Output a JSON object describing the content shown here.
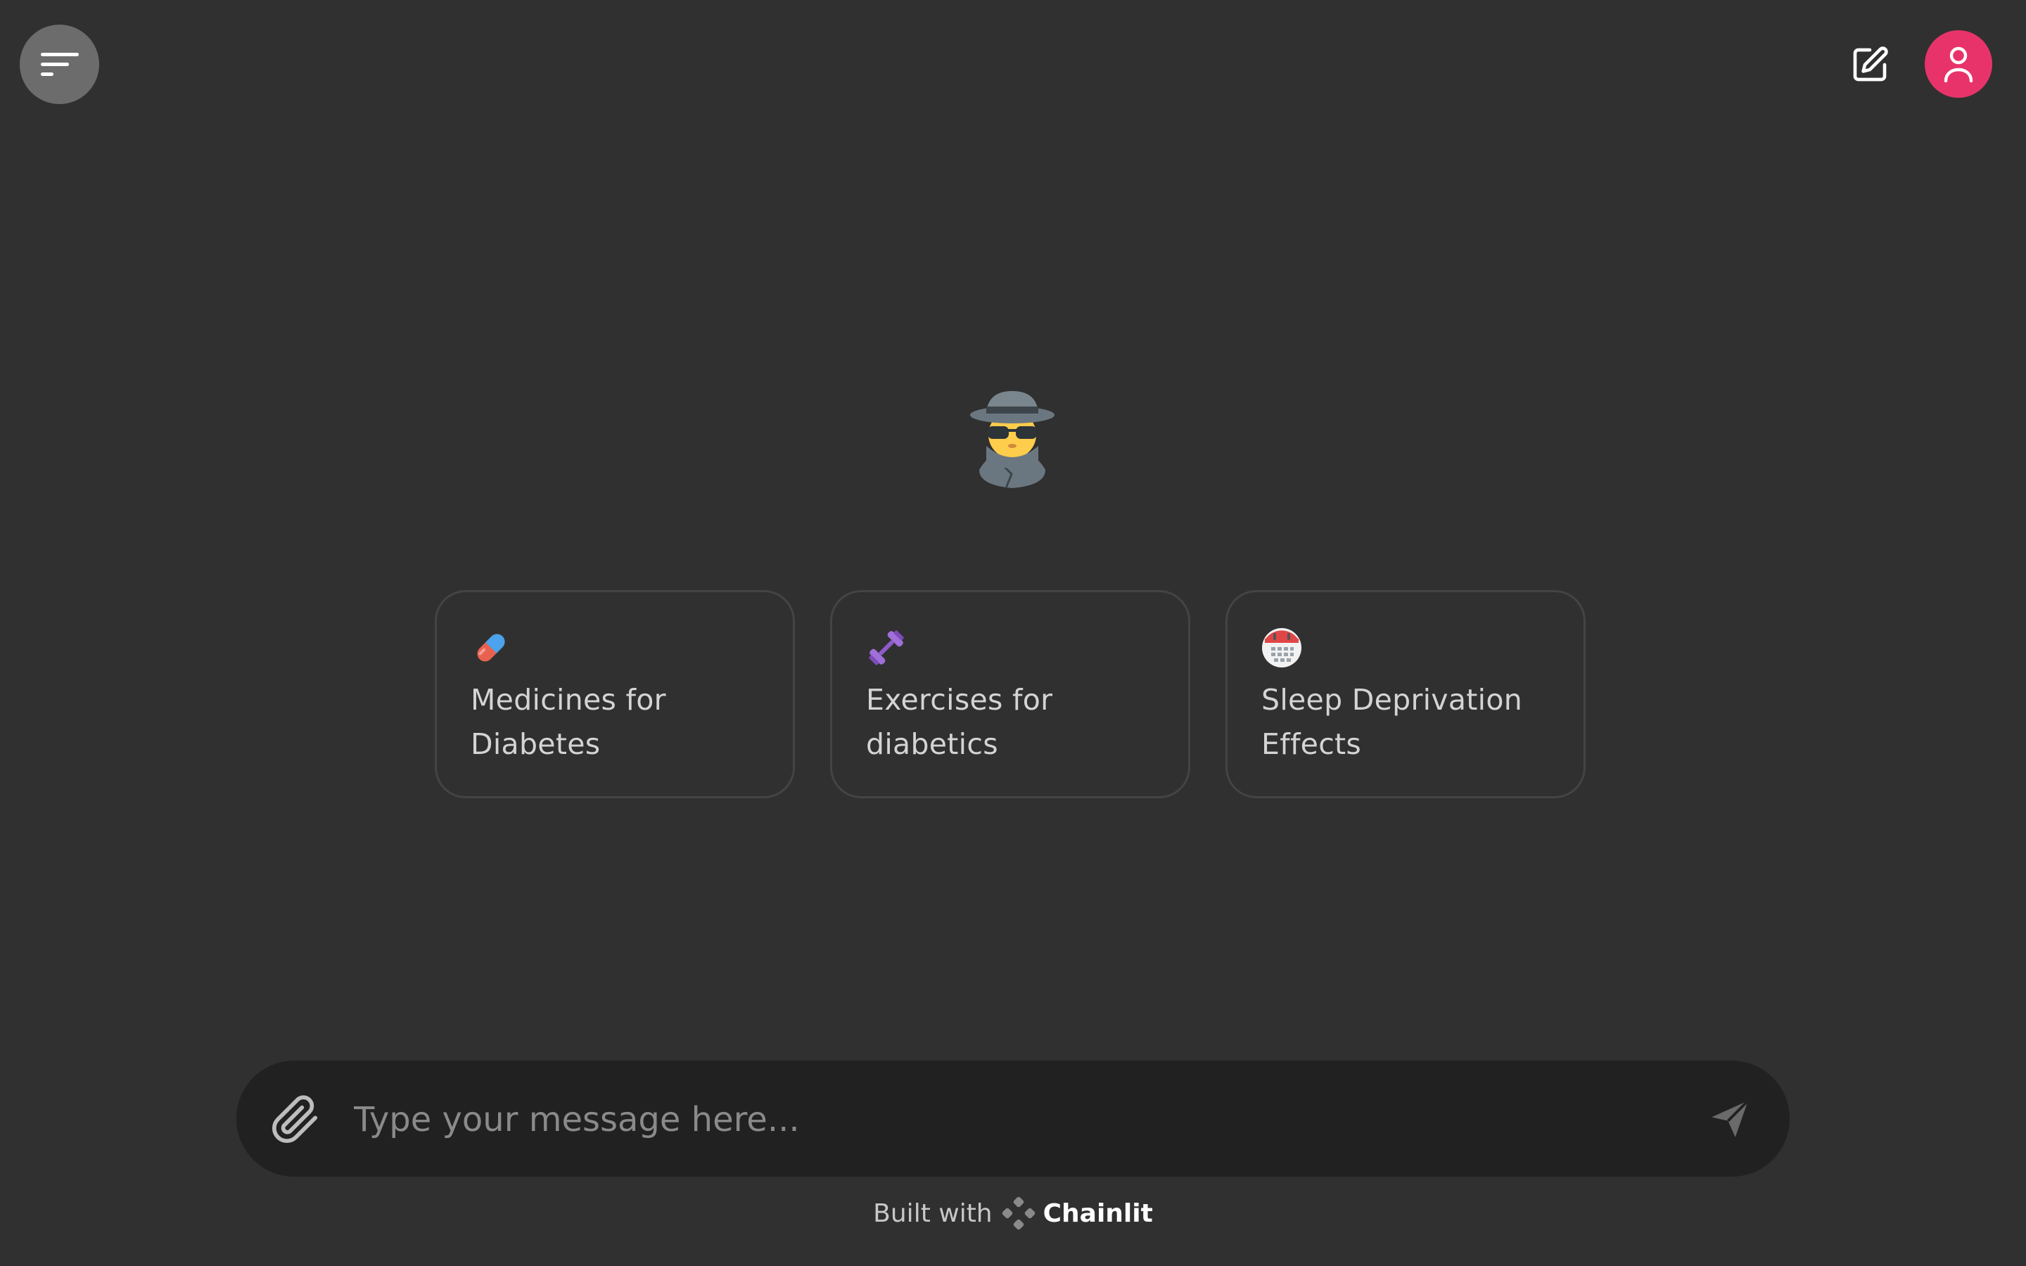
{
  "header": {
    "menu_icon": "sidebar-toggle-icon",
    "new_chat_icon": "pencil-square-icon",
    "avatar_icon": "user-icon",
    "avatar_color": "#e8336a"
  },
  "logo": {
    "icon": "detective-emoji"
  },
  "starters": [
    {
      "icon": "pill-emoji",
      "label": "Medicines for Diabetes"
    },
    {
      "icon": "dumbbell-emoji",
      "label": "Exercises for diabetics"
    },
    {
      "icon": "calendar-emoji",
      "label": "Sleep Deprivation Effects"
    }
  ],
  "composer": {
    "placeholder": "Type your message here...",
    "value": "",
    "attach_icon": "paperclip-icon",
    "send_icon": "send-icon"
  },
  "footer": {
    "prefix": "Built with",
    "brand": "Chainlit"
  },
  "colors": {
    "background": "#303030",
    "composer_background": "#212121",
    "card_border": "#444444"
  }
}
